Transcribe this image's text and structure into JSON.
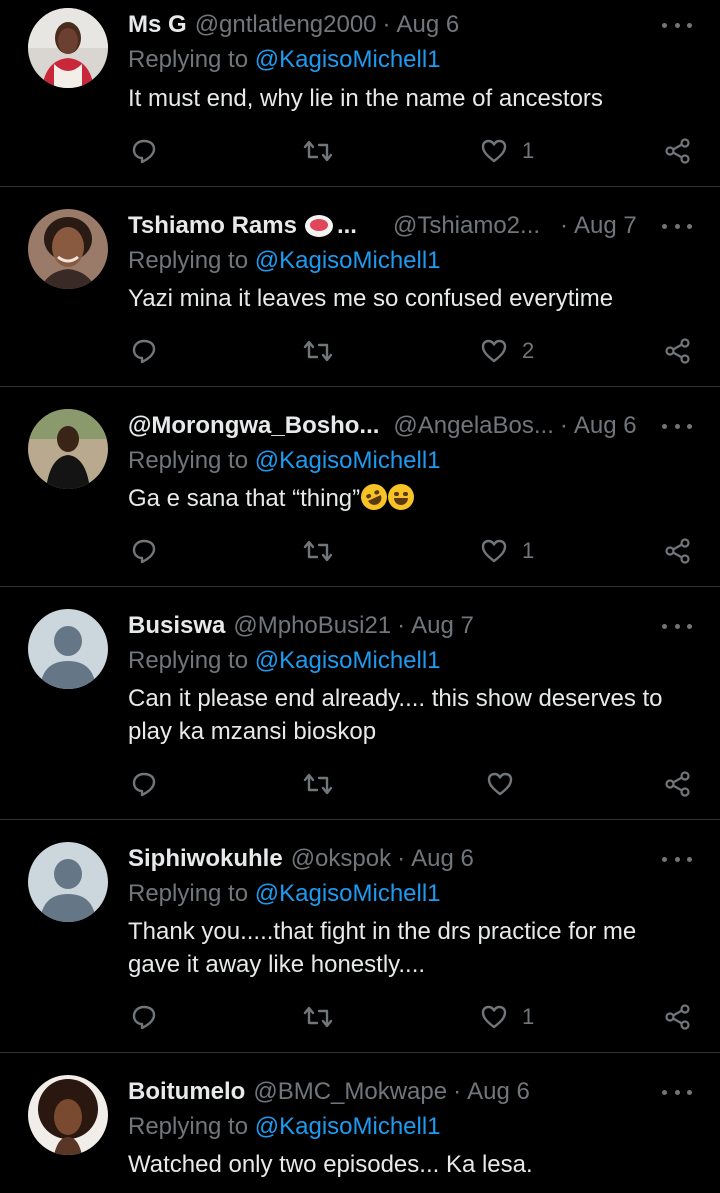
{
  "replying_to_label": "Replying to",
  "tweets": [
    {
      "name": "Ms G",
      "handle": "@gntlatleng2000",
      "date": "Aug 6",
      "mention": "@KagisoMichell1",
      "text": "It must end, why lie in the name of ancestors",
      "likes": "1",
      "avatar": "photo-woman-red-top"
    },
    {
      "name": "Tshiamo Rams",
      "name_suffix": "...",
      "handle": "@Tshiamo2...",
      "date": "Aug 7",
      "mention": "@KagisoMichell1",
      "text": "Yazi mina it leaves me so confused everytime",
      "likes": "2",
      "avatar": "photo-woman-smiling"
    },
    {
      "name": "@Morongwa_Bosho...",
      "handle": "@AngelaBos...",
      "date": "Aug 6",
      "mention": "@KagisoMichell1",
      "text": "Ga e sana that “thing”",
      "emojis": [
        "rolling-on-floor-laughing-emoji",
        "face-with-tears-of-joy-emoji"
      ],
      "likes": "1",
      "avatar": "photo-woman-outdoors"
    },
    {
      "name": "Busiswa",
      "handle": "@MphoBusi21",
      "date": "Aug 7",
      "mention": "@KagisoMichell1",
      "text": "Can it please end already.... this show deserves to play ka mzansi bioskop",
      "likes": "",
      "avatar": "default-avatar"
    },
    {
      "name": "Siphiwokuhle",
      "handle": "@okspok",
      "date": "Aug 6",
      "mention": "@KagisoMichell1",
      "text": "Thank you.....that fight in the drs practice for me gave it away like honestly....",
      "likes": "1",
      "avatar": "default-avatar"
    },
    {
      "name": "Boitumelo",
      "handle": "@BMC_Mokwape",
      "date": "Aug 6",
      "mention": "@KagisoMichell1",
      "text": "Watched only two episodes... Ka lesa.",
      "likes": "",
      "avatar": "photo-woman-afro"
    }
  ],
  "colors": {
    "background": "#000000",
    "text": "#e7e9ea",
    "secondary": "#71767b",
    "link": "#1d9bf0",
    "divider": "#2f3336"
  }
}
